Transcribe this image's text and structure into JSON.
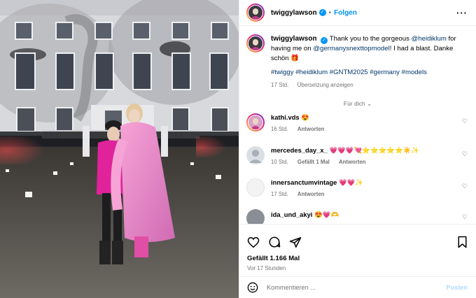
{
  "post": {
    "username": "twiggylawson",
    "follow_label": "Folgen",
    "dot": "•",
    "more_label": "···"
  },
  "caption": {
    "username": "twiggylawson",
    "text_before": "Thank you to the gorgeous ",
    "mention1": "@heidiklum",
    "text_mid": " for having me on ",
    "mention2": "@germanysnexttopmodel",
    "text_after": "! I had a blast. Danke schön 🎁",
    "hashtags": "#twiggy #heidiklum #GNTM2025 #germany #models",
    "age": "17 Std.",
    "translate_label": "Übersetzung anzeigen"
  },
  "for_you_label": "Für dich",
  "comments": [
    {
      "username": "kathi.vds",
      "text": "😍",
      "age": "16 Std.",
      "likes": "",
      "reply_label": "Antworten",
      "avatar_color": "#d9a1c4"
    },
    {
      "username": "mercedes_day_x_",
      "text": "💗💗💗💘⭐⭐⭐⭐⭐☀️✨",
      "age": "10 Std.",
      "likes": "Gefällt 1 Mal",
      "reply_label": "Antworten",
      "avatar_color": "#cdd2d8"
    },
    {
      "username": "innersanctumvintage",
      "text": "💗💗✨",
      "age": "17 Std.",
      "likes": "",
      "reply_label": "Antworten",
      "avatar_color": "#eeeeee"
    },
    {
      "username": "ida_und_akyi",
      "text": "😍💗🫶",
      "age": "",
      "likes": "",
      "reply_label": "",
      "avatar_color": "#8a8f96"
    }
  ],
  "likes_label": "Gefällt 1.166 Mal",
  "posted_ago": "Vor 17 Stunden",
  "comment_placeholder": "Kommentieren ...",
  "post_button_label": "Posten",
  "colors": {
    "link": "#00376b",
    "accent": "#0095f6",
    "muted": "#737373",
    "post_disabled": "#b3dbff"
  }
}
